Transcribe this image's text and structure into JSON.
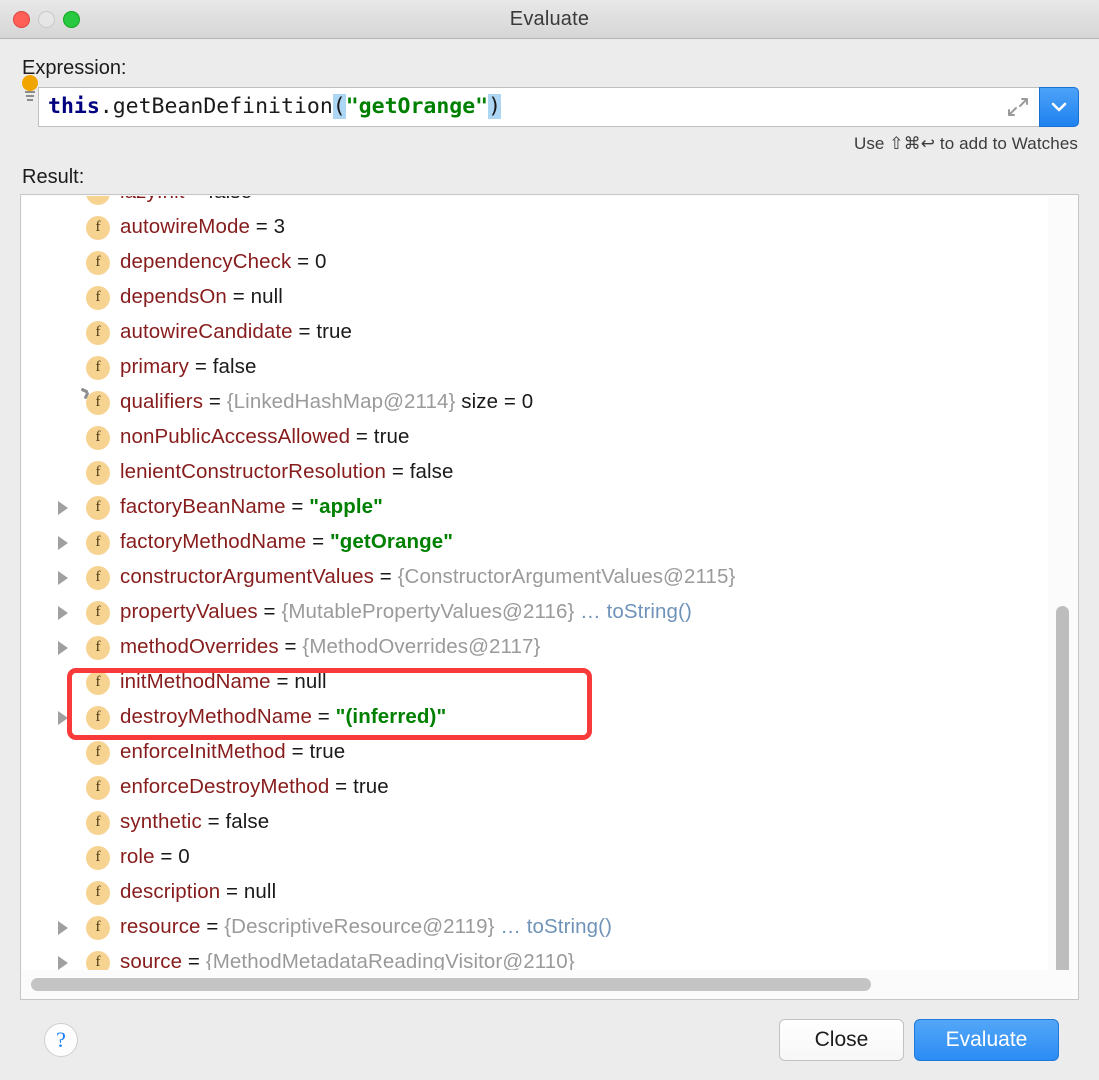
{
  "window": {
    "title": "Evaluate",
    "traffic_lights": [
      "close-button",
      "minimize-button",
      "zoom-button"
    ]
  },
  "expression_section": {
    "label": "Expression:",
    "tokens": [
      {
        "text": "this",
        "kind": "keyword",
        "selected": false
      },
      {
        "text": ".getBeanDefinition",
        "kind": "plain",
        "selected": false
      },
      {
        "text": "(",
        "kind": "plain",
        "selected": true
      },
      {
        "text": "\"getOrange\"",
        "kind": "string",
        "selected": false
      },
      {
        "text": ")",
        "kind": "plain",
        "selected": true
      }
    ],
    "full_value": "this.getBeanDefinition(\"getOrange\")",
    "bulb_icon": "lightbulb-icon",
    "expand_icon": "expand-diagonal-icon",
    "dropdown_icon": "chevron-down-icon",
    "hint": "Use ⇧⌘↩ to add to Watches"
  },
  "result_section": {
    "label": "Result:",
    "rows": [
      {
        "expandable": false,
        "name": "lazyInit",
        "eq": "=",
        "value": "false",
        "value_kind": "plain",
        "badge": false,
        "clipped": true
      },
      {
        "expandable": false,
        "name": "autowireMode",
        "eq": "=",
        "value": "3",
        "value_kind": "plain",
        "badge": false
      },
      {
        "expandable": false,
        "name": "dependencyCheck",
        "eq": "=",
        "value": "0",
        "value_kind": "plain",
        "badge": false
      },
      {
        "expandable": false,
        "name": "dependsOn",
        "eq": "=",
        "value": "null",
        "value_kind": "plain",
        "badge": false
      },
      {
        "expandable": false,
        "name": "autowireCandidate",
        "eq": "=",
        "value": "true",
        "value_kind": "plain",
        "badge": false
      },
      {
        "expandable": false,
        "name": "primary",
        "eq": "=",
        "value": "false",
        "value_kind": "plain",
        "badge": false
      },
      {
        "expandable": false,
        "name": "qualifiers",
        "eq": "=",
        "value": "{LinkedHashMap@2114}",
        "value_kind": "ref",
        "suffix": "size = 0",
        "badge": true
      },
      {
        "expandable": false,
        "name": "nonPublicAccessAllowed",
        "eq": "=",
        "value": "true",
        "value_kind": "plain",
        "badge": false
      },
      {
        "expandable": false,
        "name": "lenientConstructorResolution",
        "eq": "=",
        "value": "false",
        "value_kind": "plain",
        "badge": false
      },
      {
        "expandable": true,
        "name": "factoryBeanName",
        "eq": "=",
        "value": "\"apple\"",
        "value_kind": "string",
        "badge": false,
        "highlighted": true
      },
      {
        "expandable": true,
        "name": "factoryMethodName",
        "eq": "=",
        "value": "\"getOrange\"",
        "value_kind": "string",
        "badge": false,
        "highlighted": true
      },
      {
        "expandable": true,
        "name": "constructorArgumentValues",
        "eq": "=",
        "value": "{ConstructorArgumentValues@2115}",
        "value_kind": "ref",
        "badge": false
      },
      {
        "expandable": true,
        "name": "propertyValues",
        "eq": "=",
        "value": "{MutablePropertyValues@2116}",
        "value_kind": "ref",
        "link": "… toString()",
        "badge": false
      },
      {
        "expandable": true,
        "name": "methodOverrides",
        "eq": "=",
        "value": "{MethodOverrides@2117}",
        "value_kind": "ref",
        "badge": false
      },
      {
        "expandable": false,
        "name": "initMethodName",
        "eq": "=",
        "value": "null",
        "value_kind": "plain",
        "badge": false
      },
      {
        "expandable": true,
        "name": "destroyMethodName",
        "eq": "=",
        "value": "\"(inferred)\"",
        "value_kind": "string",
        "badge": false
      },
      {
        "expandable": false,
        "name": "enforceInitMethod",
        "eq": "=",
        "value": "true",
        "value_kind": "plain",
        "badge": false
      },
      {
        "expandable": false,
        "name": "enforceDestroyMethod",
        "eq": "=",
        "value": "true",
        "value_kind": "plain",
        "badge": false
      },
      {
        "expandable": false,
        "name": "synthetic",
        "eq": "=",
        "value": "false",
        "value_kind": "plain",
        "badge": false
      },
      {
        "expandable": false,
        "name": "role",
        "eq": "=",
        "value": "0",
        "value_kind": "plain",
        "badge": false
      },
      {
        "expandable": false,
        "name": "description",
        "eq": "=",
        "value": "null",
        "value_kind": "plain",
        "badge": false
      },
      {
        "expandable": true,
        "name": "resource",
        "eq": "=",
        "value": "{DescriptiveResource@2119}",
        "value_kind": "ref",
        "link": "… toString()",
        "badge": false
      },
      {
        "expandable": true,
        "name": "source",
        "eq": "=",
        "value": "{MethodMetadataReadingVisitor@2110}",
        "value_kind": "ref",
        "badge": false
      }
    ],
    "field_icon_letter": "f",
    "highlight_color": "#f83a3a"
  },
  "footer": {
    "help_label": "?",
    "close_label": "Close",
    "evaluate_label": "Evaluate",
    "accent_color": "#2b8cf4"
  }
}
